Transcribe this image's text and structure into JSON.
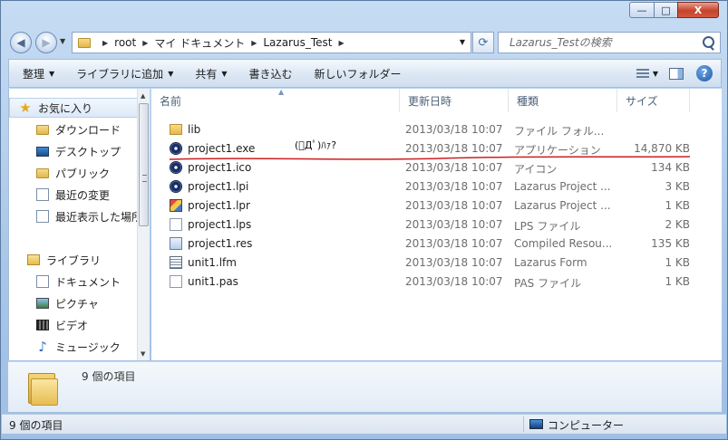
{
  "window": {
    "controls": {
      "minimize": "—",
      "maximize": "□",
      "close": "X"
    }
  },
  "navigation": {
    "back_icon": "arrow-left",
    "forward_icon": "arrow-right"
  },
  "address": {
    "crumbs": [
      "root",
      "マイ ドキュメント",
      "Lazarus_Test"
    ]
  },
  "search": {
    "placeholder": "Lazarus_Testの検索"
  },
  "toolbar": {
    "organize": "整理",
    "add_to_library": "ライブラリに追加",
    "share": "共有",
    "burn": "書き込む",
    "new_folder": "新しいフォルダー"
  },
  "sidebar": {
    "favorites": {
      "header": "お気に入り",
      "items": [
        "ダウンロード",
        "デスクトップ",
        "パブリック",
        "最近の変更",
        "最近表示した場所"
      ]
    },
    "libraries": {
      "header": "ライブラリ",
      "items": [
        "ドキュメント",
        "ピクチャ",
        "ビデオ",
        "ミュージック"
      ]
    }
  },
  "columns": {
    "name": "名前",
    "date": "更新日時",
    "type": "種類",
    "size": "サイズ"
  },
  "files": [
    {
      "name": "lib",
      "date": "2013/03/18 10:07",
      "type": "ファイル フォル...",
      "size": "",
      "icon": "folder"
    },
    {
      "name": "project1.exe",
      "date": "2013/03/18 10:07",
      "type": "アプリケーション",
      "size": "14,870 KB",
      "icon": "lazarus"
    },
    {
      "name": "project1.ico",
      "date": "2013/03/18 10:07",
      "type": "アイコン",
      "size": "134 KB",
      "icon": "lazarus"
    },
    {
      "name": "project1.lpi",
      "date": "2013/03/18 10:07",
      "type": "Lazarus Project ...",
      "size": "3 KB",
      "icon": "lazarus"
    },
    {
      "name": "project1.lpr",
      "date": "2013/03/18 10:07",
      "type": "Lazarus Project ...",
      "size": "1 KB",
      "icon": "lazarus-lpr"
    },
    {
      "name": "project1.lps",
      "date": "2013/03/18 10:07",
      "type": "LPS ファイル",
      "size": "2 KB",
      "icon": "document"
    },
    {
      "name": "project1.res",
      "date": "2013/03/18 10:07",
      "type": "Compiled Resou...",
      "size": "135 KB",
      "icon": "resource"
    },
    {
      "name": "unit1.lfm",
      "date": "2013/03/18 10:07",
      "type": "Lazarus Form",
      "size": "1 KB",
      "icon": "form"
    },
    {
      "name": "unit1.pas",
      "date": "2013/03/18 10:07",
      "type": "PAS ファイル",
      "size": "1 KB",
      "icon": "document"
    }
  ],
  "annotation": {
    "text": "(ﾟДﾟ)ﾊｧ?",
    "underline_color": "#cc1f1f"
  },
  "details": {
    "count": "9 個の項目"
  },
  "status": {
    "left": "9 個の項目",
    "right": "コンピューター"
  },
  "colors": {
    "selection": "#dce9f7",
    "accent": "#3c5d85"
  }
}
